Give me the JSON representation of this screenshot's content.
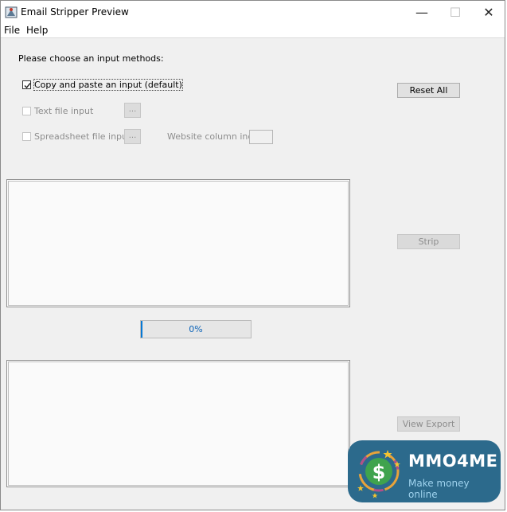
{
  "window": {
    "title": "Email Stripper Preview",
    "controls": {
      "minimize": "—",
      "maximize": "☐",
      "close": "✕"
    }
  },
  "menu": {
    "file": "File",
    "help": "Help"
  },
  "input_methods": {
    "prompt": "Please choose an input methods:",
    "copy_paste": {
      "label": "Copy and paste an input (default)",
      "checked": true,
      "enabled": true
    },
    "text_file": {
      "label": "Text file input",
      "checked": false,
      "enabled": false,
      "browse": "..."
    },
    "spreadsheet": {
      "label": "Spreadsheet file input",
      "checked": false,
      "enabled": false,
      "browse": "..."
    },
    "website_column": {
      "label": "Website column index:",
      "value": ""
    }
  },
  "buttons": {
    "reset_all": "Reset All",
    "strip": "Strip",
    "view_export": "View Export"
  },
  "input_text": "",
  "output_text": "",
  "progress": {
    "value": 0.0,
    "label": "0%"
  },
  "watermark": {
    "title": "MMO4ME",
    "subtitle": "Make money online",
    "symbol": "$"
  },
  "colors": {
    "progress_accent": "#0678d4",
    "watermark_bg": "#2c6a8c"
  }
}
